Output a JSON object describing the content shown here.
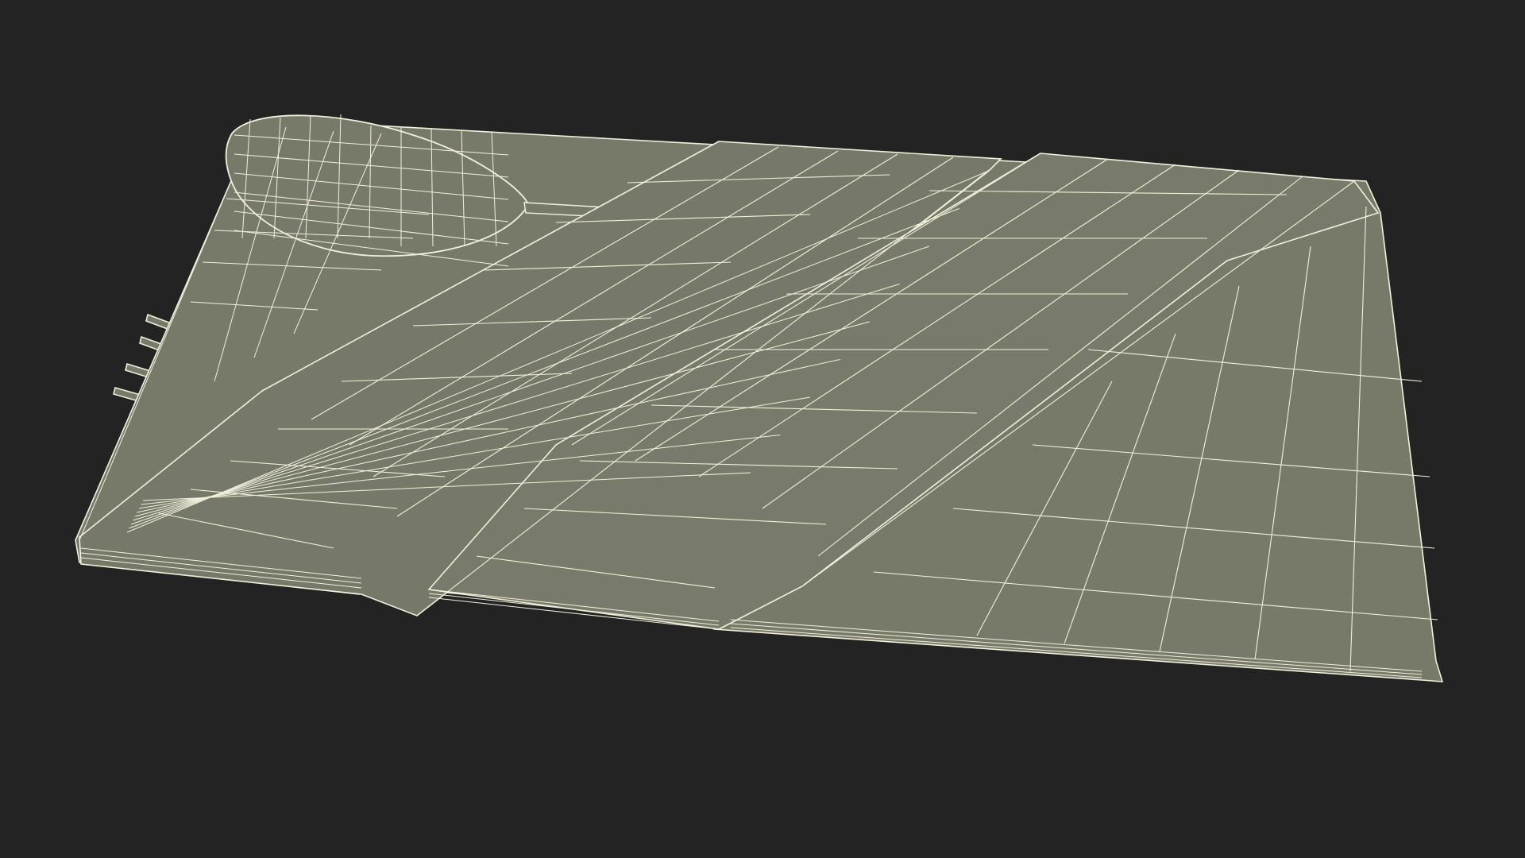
{
  "scene": {
    "subject": "napkin-with-cutlery-wireframe",
    "colors": {
      "background": "#232323",
      "surface": "#777a69",
      "surface_dark": "#6c6f5f",
      "surface_light": "#7d8070",
      "wire": "#f1f0dc",
      "shadow": "#1c1c1c"
    },
    "objects": [
      "napkin-base",
      "napkin-fold-left",
      "napkin-fold-right",
      "spoon",
      "knife",
      "fork"
    ]
  }
}
